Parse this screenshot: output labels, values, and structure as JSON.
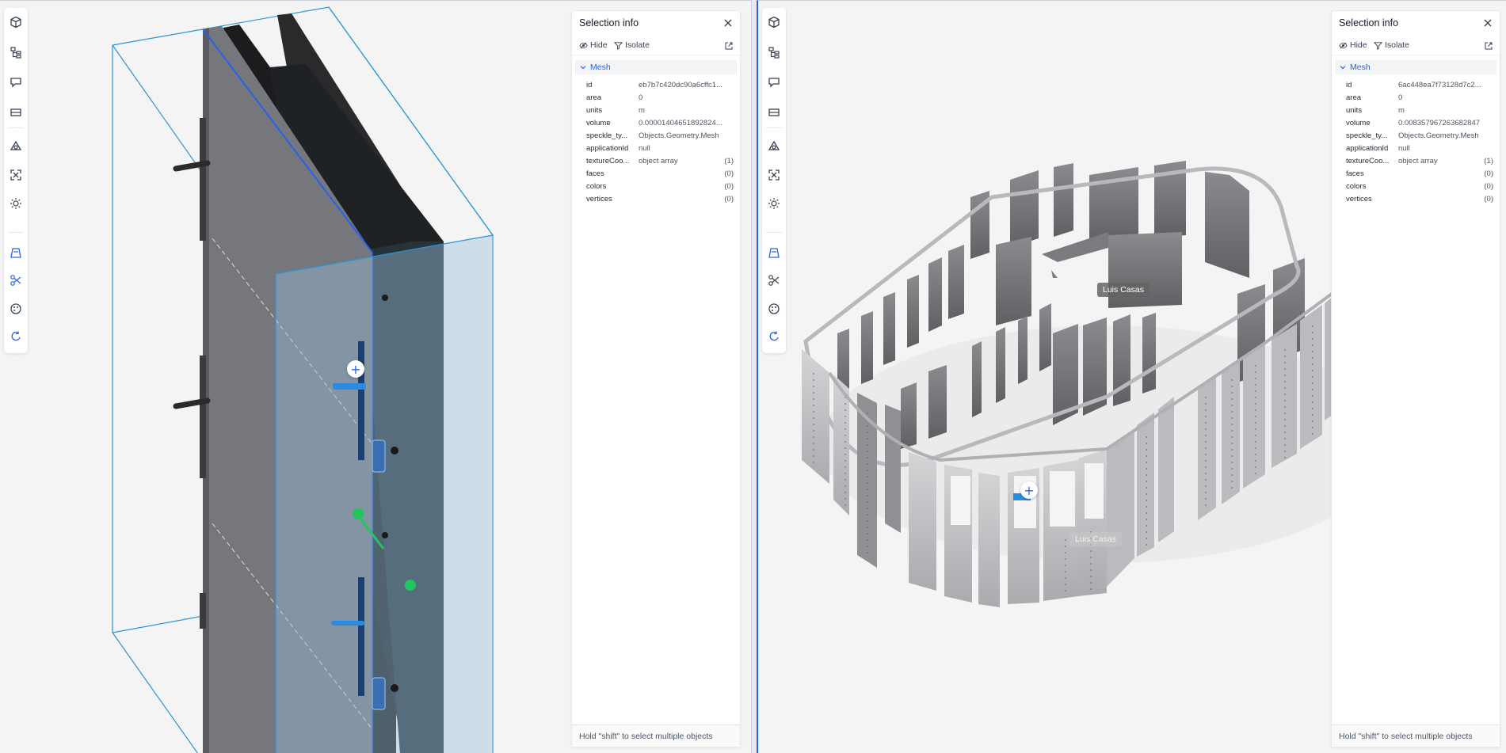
{
  "left": {
    "selection": {
      "title": "Selection info",
      "hide_label": "Hide",
      "isolate_label": "Isolate",
      "section_label": "Mesh",
      "rows": [
        {
          "key": "id",
          "value": "eb7b7c420dc90a6cffc1...",
          "count": ""
        },
        {
          "key": "area",
          "value": "0",
          "count": ""
        },
        {
          "key": "units",
          "value": "m",
          "count": ""
        },
        {
          "key": "volume",
          "value": "0.00001404651892824...",
          "count": ""
        },
        {
          "key": "speckle_ty...",
          "value": "Objects.Geometry.Mesh",
          "count": ""
        },
        {
          "key": "applicationId",
          "value": "null",
          "count": ""
        },
        {
          "key": "textureCoo...",
          "value": "object array",
          "count": "(1)"
        },
        {
          "key": "faces",
          "value": "",
          "count": "(0)"
        },
        {
          "key": "colors",
          "value": "",
          "count": "(0)"
        },
        {
          "key": "vertices",
          "value": "",
          "count": "(0)"
        }
      ],
      "footer": "Hold \"shift\" to select multiple objects"
    }
  },
  "right": {
    "selection": {
      "title": "Selection info",
      "hide_label": "Hide",
      "isolate_label": "Isolate",
      "section_label": "Mesh",
      "rows": [
        {
          "key": "id",
          "value": "6ac448ea7f73128d7c2...",
          "count": ""
        },
        {
          "key": "area",
          "value": "0",
          "count": ""
        },
        {
          "key": "units",
          "value": "m",
          "count": ""
        },
        {
          "key": "volume",
          "value": "0.008357967263682847",
          "count": ""
        },
        {
          "key": "speckle_ty...",
          "value": "Objects.Geometry.Mesh",
          "count": ""
        },
        {
          "key": "applicationId",
          "value": "null",
          "count": ""
        },
        {
          "key": "textureCoo...",
          "value": "object array",
          "count": "(1)"
        },
        {
          "key": "faces",
          "value": "",
          "count": "(0)"
        },
        {
          "key": "colors",
          "value": "",
          "count": "(0)"
        },
        {
          "key": "vertices",
          "value": "",
          "count": "(0)"
        }
      ],
      "footer": "Hold \"shift\" to select multiple objects"
    },
    "cursor_user": "Luis Casas",
    "cursor_user_ghost": "Luis Casas"
  },
  "toolbar_icons": [
    "models-icon",
    "explorer-tree-icon",
    "discussions-icon",
    "measure-icon",
    "view-modes-icon",
    "zoom-extents-icon",
    "light-icon",
    "section-box-icon",
    "scissors-icon",
    "filter-palette-icon",
    "reset-icon"
  ],
  "colors": {
    "accent": "#2563eb",
    "selection_blue": "#1d8fe1",
    "panel_bg": "#ffffff",
    "viewport_bg": "#f4f4f5"
  }
}
